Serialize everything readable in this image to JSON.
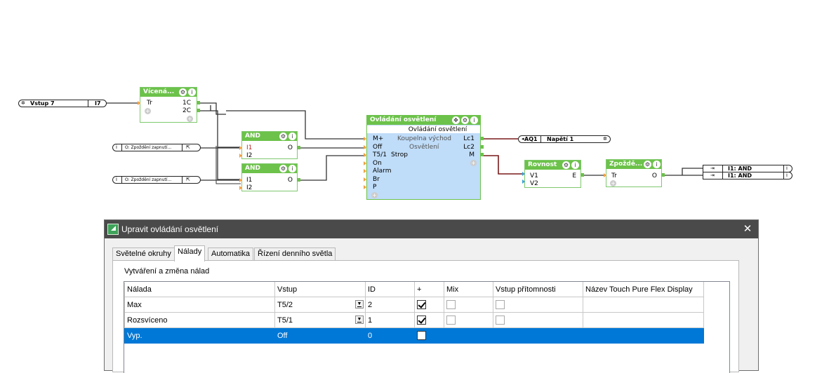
{
  "diagram": {
    "inputs": [
      {
        "name": "Vstup 7",
        "tag": "I7"
      },
      {
        "name": "O: Zpoždění zapnutí..."
      },
      {
        "name": "O: Zpoždění zapnutí..."
      }
    ],
    "blocks": {
      "stairwell": {
        "title": "Vícená...",
        "in_pins": [
          "Tr"
        ],
        "out_pins": [
          "1C",
          "2C"
        ]
      },
      "and1": {
        "title": "AND",
        "in_pins": [
          "I1",
          "I2"
        ],
        "out_pins": [
          "O"
        ]
      },
      "and2": {
        "title": "AND",
        "in_pins": [
          "I1",
          "I2"
        ],
        "out_pins": [
          "O"
        ]
      },
      "lighting": {
        "title": "Ovládání osvětlení",
        "subtitle": "Ovládání osvětlení",
        "desc1": "Koupelna východ",
        "desc2": "Osvětlení",
        "in_pins": [
          "M+",
          "Off",
          "T5/1",
          "On",
          "Alarm",
          "Br",
          "P"
        ],
        "strop": "Strop",
        "out_pins": [
          "Lc1",
          "Lc2",
          "M"
        ]
      },
      "equality": {
        "title": "Rovnost",
        "in_pins": [
          "V1",
          "V2"
        ],
        "out_pins": [
          "E"
        ]
      },
      "delay": {
        "title": "Zpoždě...",
        "in_pins": [
          "Tr"
        ],
        "out_pins": [
          "O"
        ]
      }
    },
    "outputs": [
      {
        "tag": "AQ1",
        "name": "Napětí 1"
      },
      {
        "name": "I1: AND"
      },
      {
        "name": "I1: AND"
      }
    ],
    "icons": {
      "gear": "gear-icon",
      "info": "info-icon",
      "plus": "plus-icon"
    }
  },
  "dialog": {
    "title": "Upravit ovládání osvětlení",
    "tabs": [
      "Světelné okruhy",
      "Nálady",
      "Automatika",
      "Řízení denního světla"
    ],
    "active_tab": "Nálady",
    "group_label": "Vytváření a změna nálad",
    "columns": [
      "Nálada",
      "Vstup",
      "ID",
      "+",
      "Mix",
      "Vstup přítomnosti",
      "Název Touch Pure Flex Display"
    ],
    "rows": [
      {
        "mood": "Max",
        "input": "T5/2",
        "id": "2",
        "plus": true,
        "mix": false,
        "presence": false,
        "name": "",
        "selected": false
      },
      {
        "mood": "Rozsvíceno",
        "input": "T5/1",
        "id": "1",
        "plus": true,
        "mix": false,
        "presence": false,
        "name": "",
        "selected": false
      },
      {
        "mood": "Vyp.",
        "input": "Off",
        "id": "0",
        "plus": false,
        "mix": null,
        "presence": null,
        "name": "",
        "selected": true
      }
    ]
  },
  "colors": {
    "block_header": "#6cc24a",
    "lighting_body": "#bfdcf8",
    "selection": "#0078d7",
    "title_bar": "#4a4a4a"
  }
}
